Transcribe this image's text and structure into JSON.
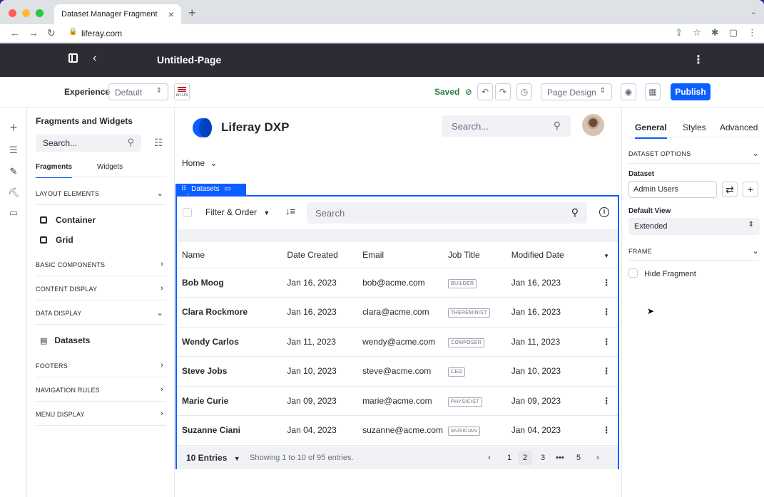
{
  "browser": {
    "tab_title": "Dataset Manager Fragment",
    "tab_close": "×",
    "new_tab": "+",
    "tab_menu": "⌄",
    "url": "liferay.com"
  },
  "topbar": {
    "page_title": "Untitled-Page"
  },
  "toolbar": {
    "experience_label": "Experience",
    "experience_value": "Default",
    "locale": "en-US",
    "saved_label": "Saved",
    "page_design_label": "Page Design",
    "publish_label": "Publish"
  },
  "fragments_panel": {
    "title": "Fragments and Widgets",
    "search_placeholder": "Search...",
    "tabs": [
      "Fragments",
      "Widgets"
    ],
    "sections": {
      "layout_elements": "LAYOUT ELEMENTS",
      "basic_components": "BASIC COMPONENTS",
      "content_display": "CONTENT DISPLAY",
      "data_display": "DATA DISPLAY",
      "footers": "FOOTERS",
      "navigation_rules": "NAVIGATION RULES",
      "menu_display": "MENU DISPLAY"
    },
    "layout_items": [
      "Container",
      "Grid"
    ],
    "data_display_items": [
      "Datasets"
    ]
  },
  "canvas": {
    "brand": "Liferay DXP",
    "search_placeholder": "Search...",
    "breadcrumb": "Home",
    "fragment_tag": "Datasets",
    "filter_label": "Filter & Order",
    "dataset_search_placeholder": "Search",
    "columns": [
      "Name",
      "Date Created",
      "Email",
      "Job Title",
      "Modified Date"
    ],
    "rows": [
      {
        "name": "Bob Moog",
        "created": "Jan 16, 2023",
        "email": "bob@acme.com",
        "job": "BUILDER",
        "modified": "Jan 16, 2023"
      },
      {
        "name": "Clara Rockmore",
        "created": "Jan 16, 2023",
        "email": "clara@acme.com",
        "job": "THEREMINIST",
        "modified": "Jan 16, 2023"
      },
      {
        "name": "Wendy Carlos",
        "created": "Jan 11, 2023",
        "email": "wendy@acme.com",
        "job": "COMPOSER",
        "modified": "Jan 11, 2023"
      },
      {
        "name": "Steve Jobs",
        "created": "Jan 10, 2023",
        "email": "steve@acme.com",
        "job": "CEO",
        "modified": "Jan 10, 2023"
      },
      {
        "name": "Marie Curie",
        "created": "Jan 09, 2023",
        "email": "marie@acme.com",
        "job": "PHYSICIST",
        "modified": "Jan 09, 2023"
      },
      {
        "name": "Suzanne Ciani",
        "created": "Jan 04, 2023",
        "email": "suzanne@acme.com",
        "job": "MUSICIAN",
        "modified": "Jan 04, 2023"
      }
    ],
    "pagination": {
      "entries_label": "10 Entries",
      "showing": "Showing 1 to 10 of 95 entries.",
      "pages": [
        "1",
        "2",
        "3",
        "•••",
        "5"
      ],
      "active_page": "2"
    }
  },
  "right_panel": {
    "tabs": [
      "General",
      "Styles",
      "Advanced"
    ],
    "dataset_options_label": "DATASET OPTIONS",
    "dataset_label": "Dataset",
    "dataset_value": "Admin Users",
    "default_view_label": "Default View",
    "default_view_value": "Extended",
    "frame_label": "FRAME",
    "hide_fragment_label": "Hide Fragment"
  },
  "colors": {
    "accent": "#0b5fff",
    "topbar": "#2b2c34",
    "saved": "#287d3c",
    "backdrop": "#3b1d8f"
  }
}
